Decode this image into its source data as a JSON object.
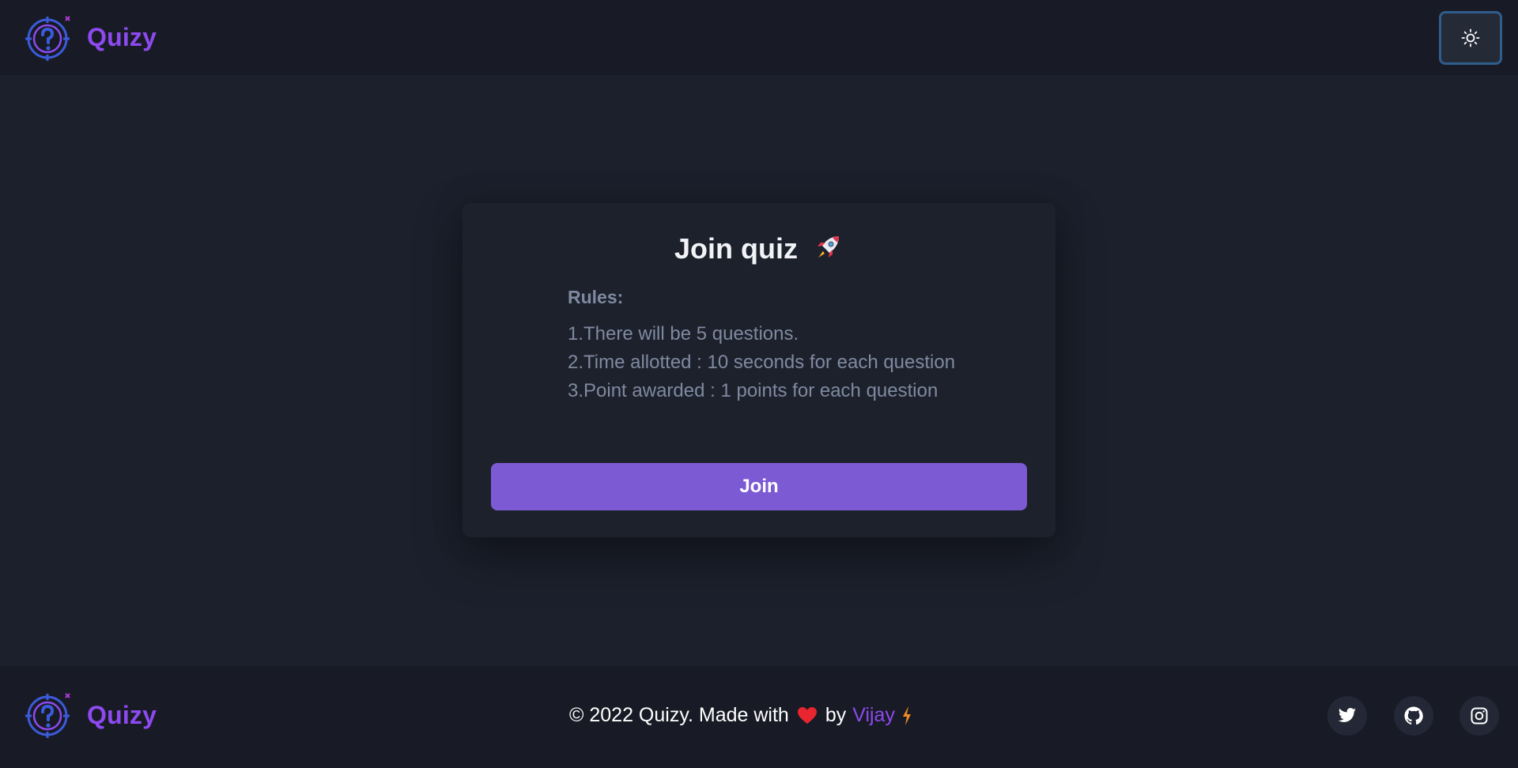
{
  "header": {
    "brand": "Quizy",
    "theme_toggle_icon": "sun-icon"
  },
  "card": {
    "title": "Join quiz",
    "title_icon": "rocket-icon",
    "rules_heading": "Rules:",
    "rules": [
      "1.There will be 5 questions.",
      "2.Time allotted : 10 seconds for each question",
      "3.Point awarded : 1 points for each question"
    ],
    "join_label": "Join"
  },
  "footer": {
    "brand": "Quizy",
    "copyright": "© 2022 Quizy. Made with",
    "by": "by",
    "author": "Vijay",
    "social": [
      "twitter-icon",
      "github-icon",
      "instagram-icon"
    ]
  },
  "colors": {
    "accent": "#8d4af0",
    "button": "#7c5ad4",
    "background": "#1c202c",
    "bar": "#181b25"
  }
}
